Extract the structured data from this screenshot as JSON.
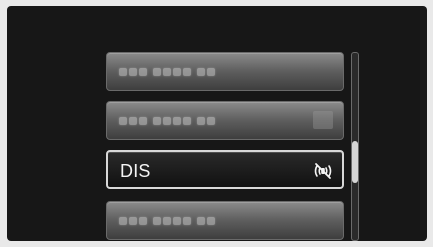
{
  "menu": {
    "items": [
      {
        "label": "",
        "state": "normal",
        "trailing_icon": null
      },
      {
        "label": "",
        "state": "normal",
        "trailing_icon": "square-icon"
      },
      {
        "label": "DIS",
        "state": "selected",
        "trailing_icon": "stabilizer-icon"
      },
      {
        "label": "",
        "state": "normal",
        "trailing_icon": null
      }
    ]
  },
  "scrollbar": {
    "thumb_position_fraction": 0.47
  },
  "colors": {
    "screen_bg": "#171717",
    "item_bg": "#6f6f6f",
    "selected_bg": "#111111",
    "selected_border": "#d8d8d8",
    "text": "#f4f4f4"
  }
}
